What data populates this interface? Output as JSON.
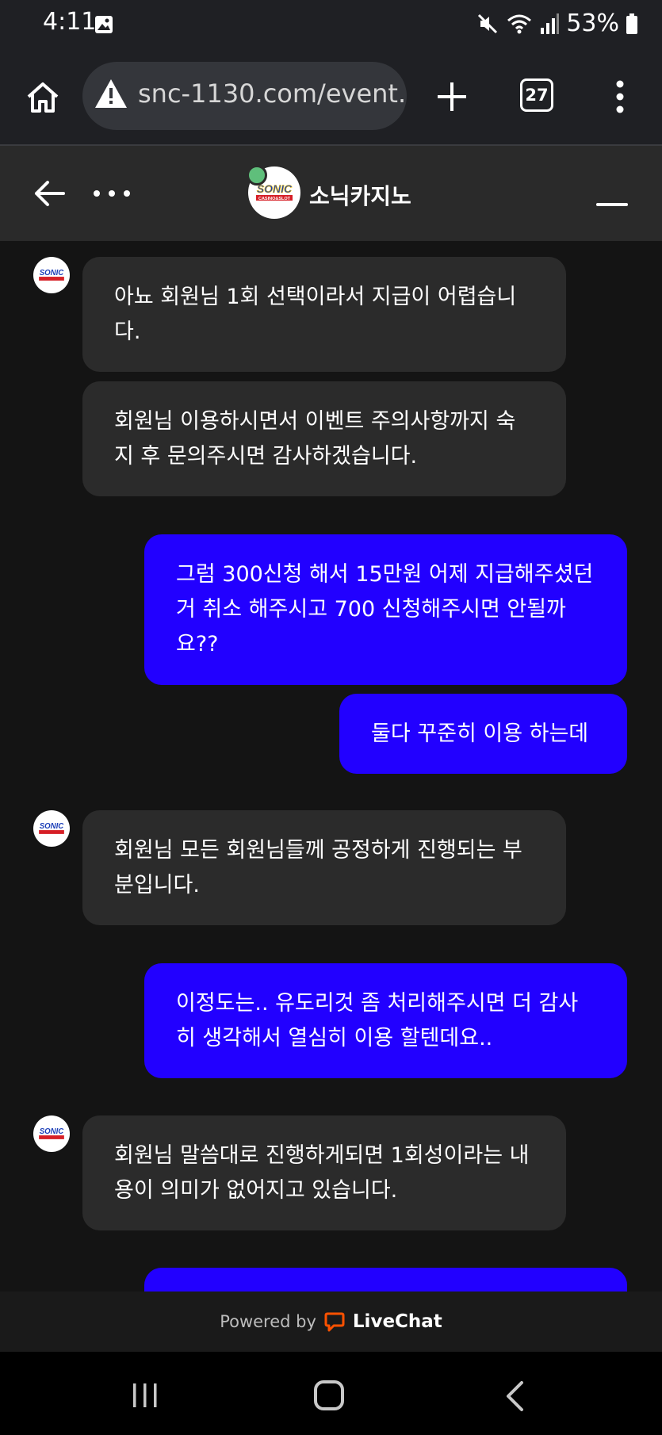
{
  "status_bar": {
    "time": "4:11",
    "battery": "53%",
    "icons": [
      "image-icon",
      "mute-icon",
      "wifi-icon",
      "signal-icon",
      "battery-icon"
    ]
  },
  "browser": {
    "url": "snc-1130.com/event.",
    "tab_count": "27"
  },
  "chat_header": {
    "agent_name": "소닉카지노",
    "logo_text": "SONIC",
    "logo_subtext": "CASINO&SLOT",
    "online_color": "#5fbf7b"
  },
  "messages": [
    {
      "from": "agent",
      "text": "아뇨 회원님 1회 선택이라서 지급이 어렵습니다."
    },
    {
      "from": "agent",
      "text": "회원님 이용하시면서 이벤트 주의사항까지 숙지 후 문의주시면 감사하겠습니다."
    },
    {
      "from": "user",
      "text": "그럼 300신청 해서 15만원 어제 지급해주셨던거 취소 해주시고 700 신청해주시면 안될까요??"
    },
    {
      "from": "user",
      "text": "둘다 꾸준히 이용 하는데"
    },
    {
      "from": "agent",
      "text": "회원님 모든 회원님들께 공정하게 진행되는 부분입니다."
    },
    {
      "from": "user",
      "text": "이정도는.. 유도리것 좀 처리해주시면 더 감사히 생각해서 열심히 이용 할텐데요.."
    },
    {
      "from": "agent",
      "text": "회원님 말씀대로 진행하게되면 1회성이라는 내용이 의미가 없어지고 있습니다."
    },
    {
      "from": "user",
      "text": ""
    }
  ],
  "footer": {
    "powered_by": "Powered by",
    "brand": "LiveChat",
    "brand_color": "#ff5100"
  },
  "colors": {
    "user_bubble": "#2200ff",
    "agent_bubble": "#2b2b2b",
    "background": "#141414"
  }
}
